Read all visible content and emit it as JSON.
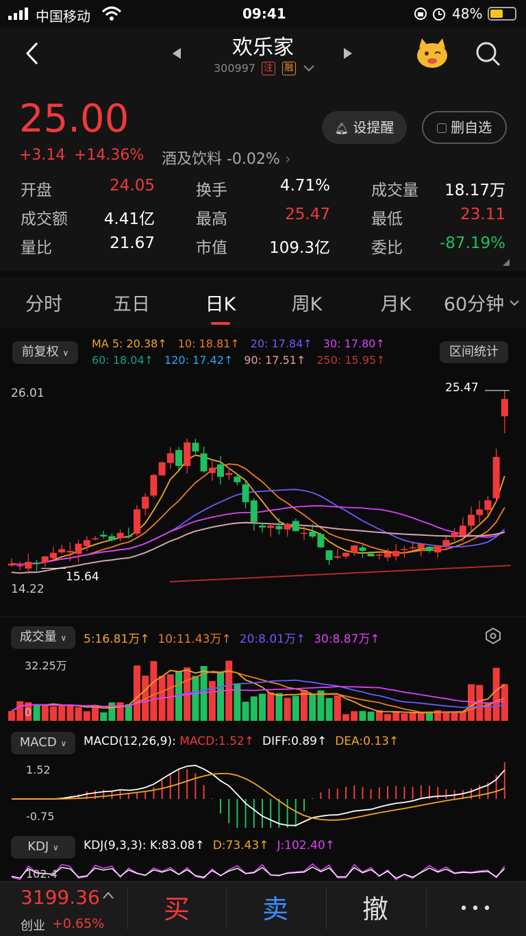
{
  "status": {
    "carrier": "中国移动",
    "time": "09:41",
    "battery": "48%"
  },
  "header": {
    "title": "欢乐家",
    "code": "300997",
    "badge1": "注",
    "badge2": "融"
  },
  "quote": {
    "price": "25.00",
    "change": "+3.14",
    "change_pct": "+14.36%",
    "sector": "酒及饮料 -0.02%",
    "alert_label": "设提醒",
    "watch_label": "删自选",
    "stats": [
      {
        "label": "开盘",
        "value": "24.05",
        "color": "red"
      },
      {
        "label": "换手",
        "value": "4.71%",
        "color": "white"
      },
      {
        "label": "成交量",
        "value": "18.17万",
        "color": "white"
      },
      {
        "label": "成交额",
        "value": "4.41亿",
        "color": "white"
      },
      {
        "label": "最高",
        "value": "25.47",
        "color": "red"
      },
      {
        "label": "最低",
        "value": "23.11",
        "color": "red"
      },
      {
        "label": "量比",
        "value": "21.67",
        "color": "white"
      },
      {
        "label": "市值",
        "value": "109.3亿",
        "color": "white"
      },
      {
        "label": "委比",
        "value": "-87.19%",
        "color": "green"
      }
    ]
  },
  "tabs": [
    "分时",
    "五日",
    "日K",
    "周K",
    "月K",
    "60分钟"
  ],
  "kline": {
    "adjust_label": "前复权",
    "range_label": "区间统计",
    "ma_row1": [
      {
        "t": "MA 5: 20.38↑",
        "c": "#f5a623"
      },
      {
        "t": "10: 18.81↑",
        "c": "#f07c24"
      },
      {
        "t": "20: 17.84↑",
        "c": "#6a5cff"
      },
      {
        "t": "30: 17.80↑",
        "c": "#e040fb"
      }
    ],
    "ma_row2": [
      {
        "t": "60: 18.04↑",
        "c": "#16a085"
      },
      {
        "t": "120: 17.42↑",
        "c": "#29a8ff"
      },
      {
        "t": "90: 17.51↑",
        "c": "#e8a0a0"
      },
      {
        "t": "250: 15.95↑",
        "c": "#c0392b"
      }
    ],
    "y_top": "26.01",
    "y_bottom": "14.22",
    "max_label": "25.47",
    "min_label": "15.64"
  },
  "volume": {
    "label": "成交量",
    "legend": [
      {
        "t": "5:16.81万↑",
        "c": "#f5a623"
      },
      {
        "t": "10:11.43万↑",
        "c": "#f07c24"
      },
      {
        "t": "20:8.01万↑",
        "c": "#6a5cff"
      },
      {
        "t": "30:8.87万↑",
        "c": "#e040fb"
      }
    ],
    "y_top": "32.25万",
    "y_bottom": "0"
  },
  "macd": {
    "label": "MACD",
    "params": "MACD(12,26,9):",
    "legend": [
      {
        "t": "MACD:1.52↑",
        "c": "#f03a3a"
      },
      {
        "t": "DIFF:0.89↑",
        "c": "#ffffff"
      },
      {
        "t": "DEA:0.13↑",
        "c": "#f5a623"
      }
    ],
    "y_top": "1.52",
    "y_bottom": "-0.75"
  },
  "kdj": {
    "label": "KDJ",
    "params": "KDJ(9,3,3):",
    "legend": [
      {
        "t": "K:83.08↑",
        "c": "#ffffff"
      },
      {
        "t": "D:73.43↑",
        "c": "#f5a623"
      },
      {
        "t": "J:102.40↑",
        "c": "#e040fb"
      }
    ],
    "y_top": "102.4"
  },
  "bottom": {
    "index_value": "3199.36",
    "index_name": "创业",
    "index_change": "+0.65%",
    "buy": "买",
    "sell": "卖",
    "cancel": "撤",
    "more": "•••"
  }
}
